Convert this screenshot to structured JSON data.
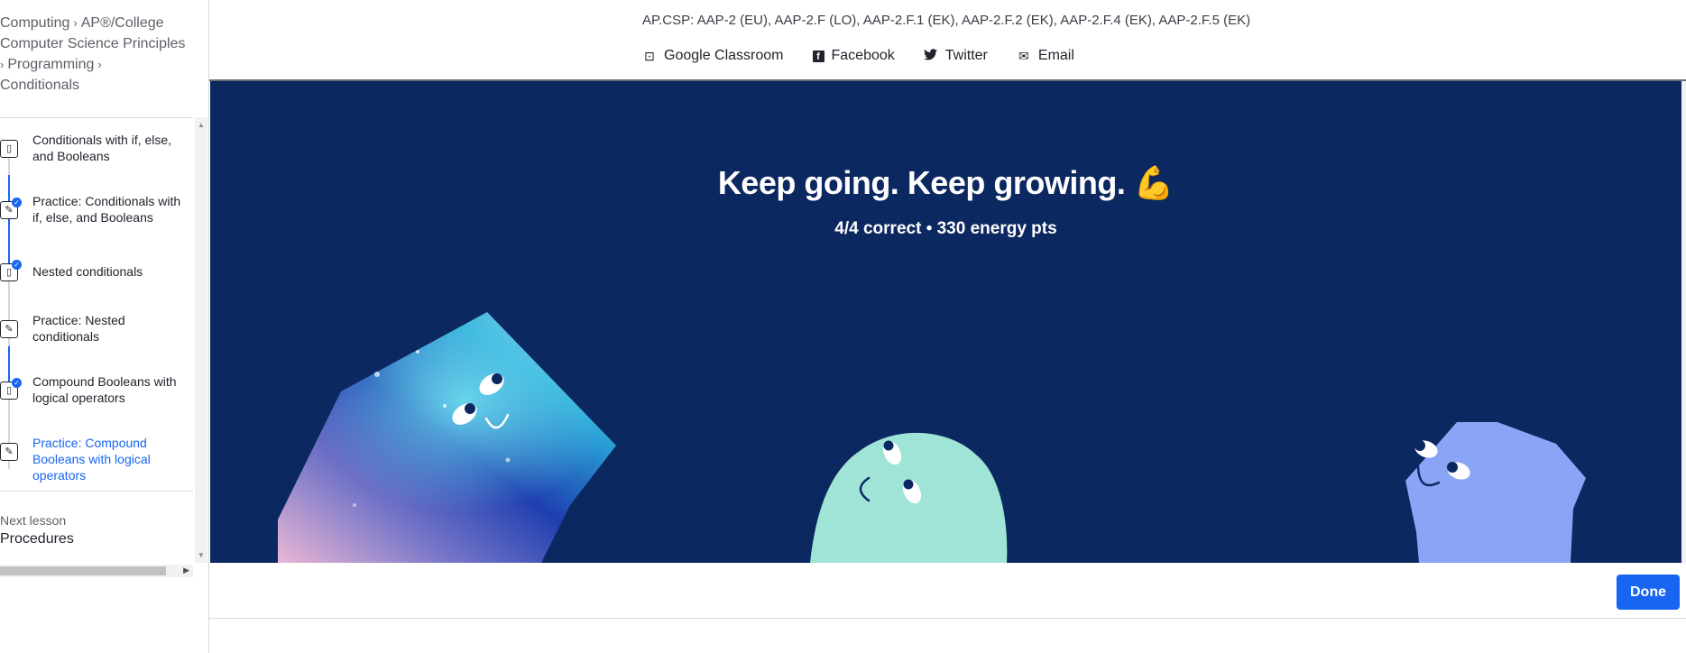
{
  "breadcrumb": {
    "items": [
      "Computing",
      "AP®︎/College Computer Science Principles",
      "Programming",
      "Conditionals"
    ],
    "separator": "›"
  },
  "lessons": [
    {
      "label": "Conditionals with if, else, and Booleans",
      "icon": "article-icon",
      "completed": false,
      "active": false
    },
    {
      "label": "Practice: Conditionals with if, else, and Booleans",
      "icon": "pencil-icon",
      "completed": true,
      "active": false
    },
    {
      "label": "Nested conditionals",
      "icon": "article-icon",
      "completed": true,
      "active": false
    },
    {
      "label": "Practice: Nested conditionals",
      "icon": "pencil-icon",
      "completed": false,
      "active": false
    },
    {
      "label": "Compound Booleans with logical operators",
      "icon": "article-icon",
      "completed": true,
      "active": false
    },
    {
      "label": "Practice: Compound Booleans with logical operators",
      "icon": "pencil-icon",
      "completed": false,
      "active": true
    }
  ],
  "next_lesson": {
    "label": "Next lesson",
    "title": "Procedures"
  },
  "header": {
    "standards": "AP.CSP: AAP‑2 (EU), AAP‑2.F (LO), AAP‑2.F.1 (EK), AAP‑2.F.2 (EK), AAP‑2.F.4 (EK), AAP‑2.F.5 (EK)",
    "share": [
      {
        "label": "Google Classroom",
        "icon": "google-classroom-icon"
      },
      {
        "label": "Facebook",
        "icon": "facebook-icon"
      },
      {
        "label": "Twitter",
        "icon": "twitter-icon"
      },
      {
        "label": "Email",
        "icon": "email-icon"
      }
    ]
  },
  "result": {
    "headline": "Keep going. Keep growing.",
    "emoji": "💪",
    "summary": "4/4 correct • 330 energy pts"
  },
  "footer": {
    "done_label": "Done"
  },
  "colors": {
    "panel_bg": "#0c2860",
    "accent": "#1865f2",
    "mint": "#9fe4d6",
    "periwinkle": "#8aa5f5"
  }
}
